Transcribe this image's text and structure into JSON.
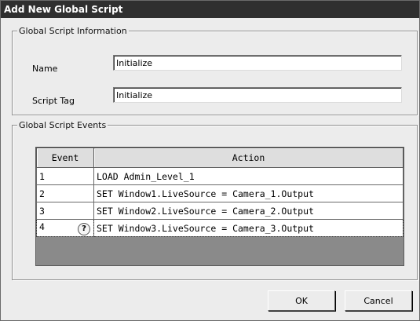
{
  "window": {
    "title": "Add New Global Script"
  },
  "info_group": {
    "legend": "Global Script Information",
    "name_label": "Name",
    "name_value": "Initialize",
    "tag_label": "Script Tag",
    "tag_value": "Initialize"
  },
  "events_group": {
    "legend": "Global Script Events",
    "columns": [
      "Event",
      "Action"
    ],
    "rows": [
      {
        "event": "1",
        "action": "LOAD Admin_Level_1"
      },
      {
        "event": "2",
        "action": "SET Window1.LiveSource = Camera_1.Output"
      },
      {
        "event": "3",
        "action": "SET Window2.LiveSource = Camera_2.Output"
      },
      {
        "event": "4",
        "action": "SET Window3.LiveSource = Camera_3.Output",
        "icon": "question-icon",
        "icon_glyph": "?"
      }
    ]
  },
  "buttons": {
    "ok": "OK",
    "cancel": "Cancel"
  }
}
